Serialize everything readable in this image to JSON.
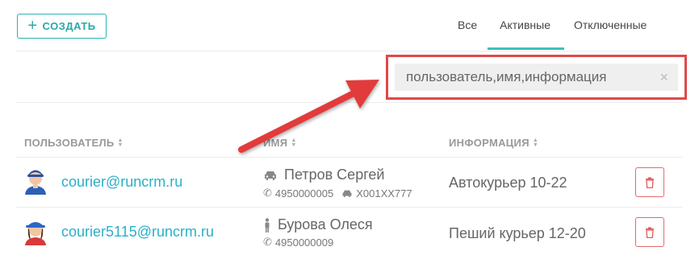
{
  "toolbar": {
    "create_label": "СОЗДАТЬ"
  },
  "tabs": [
    {
      "label": "Все",
      "active": false
    },
    {
      "label": "Активные",
      "active": true
    },
    {
      "label": "Отключенные",
      "active": false
    }
  ],
  "search": {
    "placeholder": "пользователь,имя,информация",
    "value": ""
  },
  "columns": {
    "user": "ПОЛЬЗОВАТЕЛЬ",
    "name": "ИМЯ",
    "info": "ИНФОРМАЦИЯ"
  },
  "rows": [
    {
      "email": "courier@runcrm.ru",
      "name": "Петров Сергей",
      "transport_icon": "car-icon",
      "phone": "4950000005",
      "plate": "Х001ХХ777",
      "info": "Автокурьер 10-22"
    },
    {
      "email": "courier5115@runcrm.ru",
      "name": "Бурова Олеся",
      "transport_icon": "walking-person-icon",
      "phone": "4950000009",
      "info": "Пеший курьер 12-20"
    }
  ],
  "colors": {
    "accent": "#2ab5b0",
    "link": "#2ab0c6",
    "danger": "#e04848",
    "tab_underline": "#3fc0b8"
  }
}
